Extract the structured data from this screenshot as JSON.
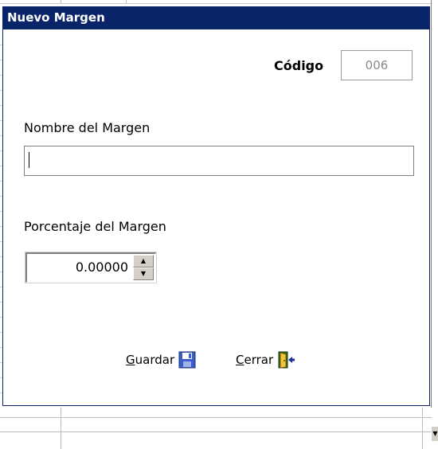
{
  "dialog": {
    "title": "Nuevo Margen",
    "codigo_label": "Código",
    "codigo_value": "006",
    "nombre_label": "Nombre del Margen",
    "nombre_value": "",
    "porcentaje_label": "Porcentaje del Margen",
    "porcentaje_value": "0.00000"
  },
  "actions": {
    "save": {
      "label_first": "G",
      "label_rest": "uardar",
      "icon": "floppy-disk-icon"
    },
    "close": {
      "label_first": "C",
      "label_rest": "errar",
      "icon": "exit-door-icon"
    }
  },
  "colors": {
    "titlebar": "#0a246a",
    "title_text": "#ffffff",
    "disabled_text": "#8a8a8a"
  }
}
